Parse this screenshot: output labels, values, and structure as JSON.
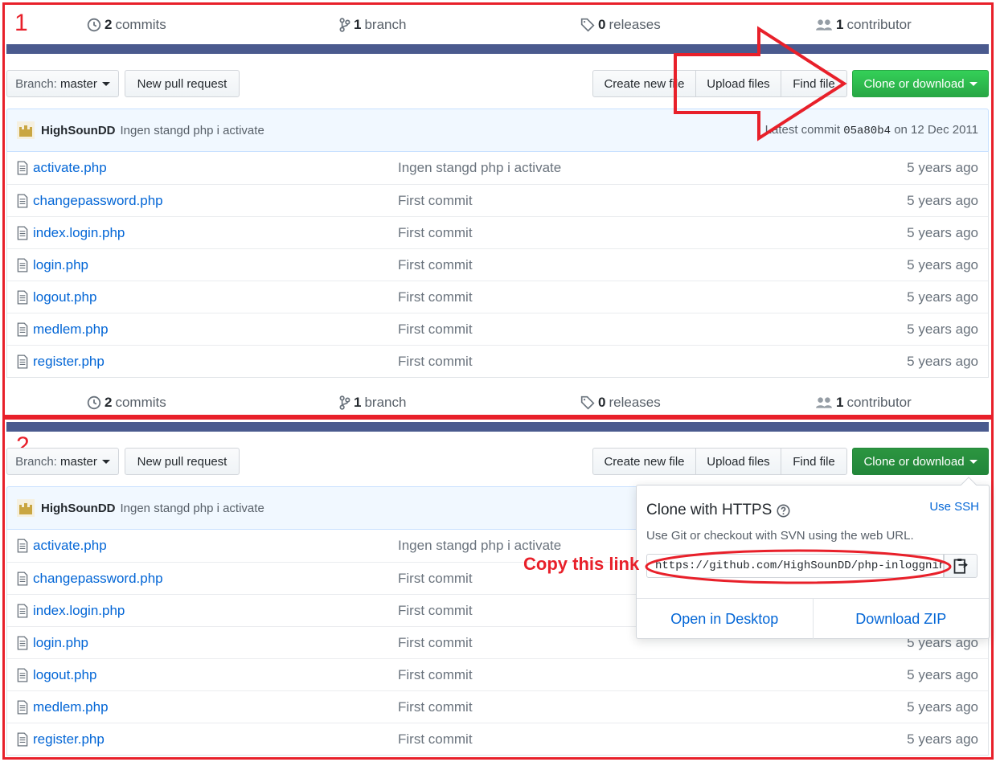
{
  "sections": [
    {
      "number": "1",
      "summary": {
        "commits": {
          "count": "2",
          "label": "commits"
        },
        "branches": {
          "count": "1",
          "label": "branch"
        },
        "releases": {
          "count": "0",
          "label": "releases"
        },
        "contributors": {
          "count": "1",
          "label": "contributor"
        }
      },
      "toolbar": {
        "branch_label": "Branch:",
        "branch_value": "master",
        "new_pull_request": "New pull request",
        "create_new_file": "Create new file",
        "upload_files": "Upload files",
        "find_file": "Find file",
        "clone_or_download": "Clone or download"
      },
      "commit": {
        "author": "HighSounDD",
        "message": "Ingen stangd php i activate",
        "latest_prefix": "Latest commit",
        "sha": "05a80b4",
        "date": "on 12 Dec 2011"
      },
      "files": [
        {
          "name": "activate.php",
          "message": "Ingen stangd php i activate",
          "age": "5 years ago"
        },
        {
          "name": "changepassword.php",
          "message": "First commit",
          "age": "5 years ago"
        },
        {
          "name": "index.login.php",
          "message": "First commit",
          "age": "5 years ago"
        },
        {
          "name": "login.php",
          "message": "First commit",
          "age": "5 years ago"
        },
        {
          "name": "logout.php",
          "message": "First commit",
          "age": "5 years ago"
        },
        {
          "name": "medlem.php",
          "message": "First commit",
          "age": "5 years ago"
        },
        {
          "name": "register.php",
          "message": "First commit",
          "age": "5 years ago"
        }
      ]
    },
    {
      "number": "2",
      "summary": {
        "commits": {
          "count": "2",
          "label": "commits"
        },
        "branches": {
          "count": "1",
          "label": "branch"
        },
        "releases": {
          "count": "0",
          "label": "releases"
        },
        "contributors": {
          "count": "1",
          "label": "contributor"
        }
      },
      "toolbar": {
        "branch_label": "Branch:",
        "branch_value": "master",
        "new_pull_request": "New pull request",
        "create_new_file": "Create new file",
        "upload_files": "Upload files",
        "find_file": "Find file",
        "clone_or_download": "Clone or download"
      },
      "commit": {
        "author": "HighSounDD",
        "message": "Ingen stangd php i activate"
      },
      "files": [
        {
          "name": "activate.php",
          "message": "Ingen stangd php i activate"
        },
        {
          "name": "changepassword.php",
          "message": "First commit"
        },
        {
          "name": "index.login.php",
          "message": "First commit"
        },
        {
          "name": "login.php",
          "message": "First commit",
          "age": "5 years ago"
        },
        {
          "name": "logout.php",
          "message": "First commit",
          "age": "5 years ago"
        },
        {
          "name": "medlem.php",
          "message": "First commit",
          "age": "5 years ago"
        },
        {
          "name": "register.php",
          "message": "First commit",
          "age": "5 years ago"
        }
      ],
      "clone_popup": {
        "title": "Clone with HTTPS",
        "use_ssh": "Use SSH",
        "description": "Use Git or checkout with SVN using the web URL.",
        "url": "https://github.com/HighSounDD/php-inloggning.git",
        "open_desktop": "Open in Desktop",
        "download_zip": "Download ZIP"
      }
    }
  ],
  "annotation": {
    "copy_label": "Copy this link"
  },
  "colors": {
    "annotation_red": "#e8202a",
    "link_blue": "#0366d6",
    "clone_green": "#28a745",
    "bar_blue": "#4a5a8e"
  }
}
